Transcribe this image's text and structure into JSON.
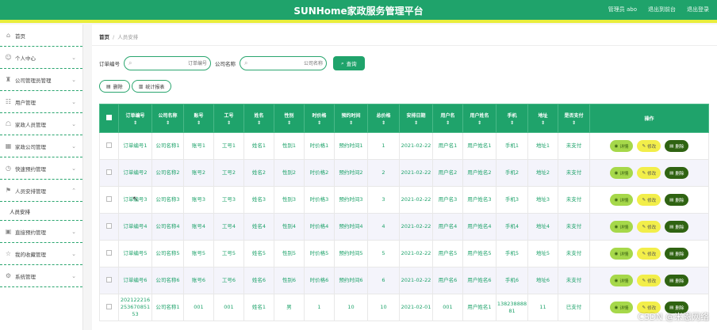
{
  "header": {
    "title": "SUNHome家政服务管理平台",
    "actions": [
      "管理员 abo",
      "退出到前台",
      "退出登录"
    ]
  },
  "colors": {
    "primary": "#1fa36b",
    "accent_bar": "#e9ee3b",
    "view_btn": "#a6d84a",
    "edit_btn": "#f2ee4a",
    "delete_btn": "#2f6312"
  },
  "sidebar": {
    "items": [
      {
        "label": "首页",
        "icon": "home-icon",
        "chevron": false
      },
      {
        "label": "个人中心",
        "icon": "user-icon",
        "chevron": true
      },
      {
        "label": "公司管理员管理",
        "icon": "admin-icon",
        "chevron": true
      },
      {
        "label": "用户管理",
        "icon": "users-icon",
        "chevron": true
      },
      {
        "label": "家政人员管理",
        "icon": "worker-icon",
        "chevron": true
      },
      {
        "label": "家政公司管理",
        "icon": "company-icon",
        "chevron": true
      },
      {
        "label": "快速预约管理",
        "icon": "clock-icon",
        "chevron": true
      },
      {
        "label": "人员安排管理",
        "icon": "flag-icon",
        "chevron": true,
        "expanded": true
      },
      {
        "label": "直接预约管理",
        "icon": "calendar-icon",
        "chevron": true
      },
      {
        "label": "我的收藏管理",
        "icon": "star-icon",
        "chevron": true
      },
      {
        "label": "系统管理",
        "icon": "settings-icon",
        "chevron": true
      }
    ],
    "subitem": "人员安排"
  },
  "breadcrumb": {
    "home": "首页",
    "sep": "/",
    "current": "人员安排"
  },
  "search": {
    "order_label": "订单编号",
    "order_placeholder": "订单编号",
    "company_label": "公司名称",
    "company_placeholder": "公司名称",
    "query_label": "查询"
  },
  "tools": {
    "delete_label": "删除",
    "stats_label": "统计报表"
  },
  "table": {
    "headers": [
      "订单编号",
      "公司名称",
      "账号",
      "工号",
      "姓名",
      "性别",
      "时价格",
      "预约时间",
      "总价格",
      "安排日期",
      "用户名",
      "用户姓名",
      "手机",
      "地址",
      "是否支付",
      "操作"
    ],
    "rows": [
      [
        "订单编号1",
        "公司名称1",
        "账号1",
        "工号1",
        "姓名1",
        "性别1",
        "时价格1",
        "预约时间1",
        "1",
        "2021-02-22",
        "用户名1",
        "用户姓名1",
        "手机1",
        "地址1",
        "未支付"
      ],
      [
        "订单编号2",
        "公司名称2",
        "账号2",
        "工号2",
        "姓名2",
        "性别2",
        "时价格2",
        "预约时间2",
        "2",
        "2021-02-22",
        "用户名2",
        "用户姓名2",
        "手机2",
        "地址2",
        "未支付"
      ],
      [
        "订单编号3",
        "公司名称3",
        "账号3",
        "工号3",
        "姓名3",
        "性别3",
        "时价格3",
        "预约时间3",
        "3",
        "2021-02-22",
        "用户名3",
        "用户姓名3",
        "手机3",
        "地址3",
        "未支付"
      ],
      [
        "订单编号4",
        "公司名称4",
        "账号4",
        "工号4",
        "姓名4",
        "性别4",
        "时价格4",
        "预约时间4",
        "4",
        "2021-02-22",
        "用户名4",
        "用户姓名4",
        "手机4",
        "地址4",
        "未支付"
      ],
      [
        "订单编号5",
        "公司名称5",
        "账号5",
        "工号5",
        "姓名5",
        "性别5",
        "时价格5",
        "预约时间5",
        "5",
        "2021-02-22",
        "用户名5",
        "用户姓名5",
        "手机5",
        "地址5",
        "未支付"
      ],
      [
        "订单编号6",
        "公司名称6",
        "账号6",
        "工号6",
        "姓名6",
        "性别6",
        "时价格6",
        "预约时间6",
        "6",
        "2021-02-22",
        "用户名6",
        "用户姓名6",
        "手机6",
        "地址6",
        "未支付"
      ],
      [
        "20212221625367085153",
        "公司名称1",
        "001",
        "001",
        "姓名1",
        "男",
        "1",
        "10",
        "10",
        "2021-02-01",
        "001",
        "用户姓名1",
        "13823888881",
        "11",
        "已支付"
      ]
    ],
    "ops": {
      "view": "详情",
      "edit": "修改",
      "delete": "删除"
    }
  },
  "watermark": "CSDN @米恩网络"
}
